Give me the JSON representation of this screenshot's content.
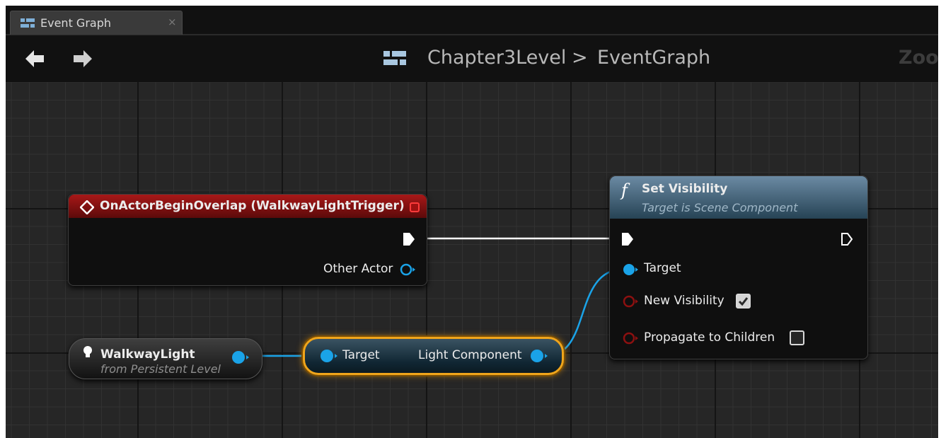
{
  "tab": {
    "label": "Event Graph",
    "close": "×"
  },
  "breadcrumb": {
    "level": "Chapter3Level",
    "separator": ">",
    "graph": "EventGraph",
    "zoom": "Zoom"
  },
  "nodes": {
    "overlap_event": {
      "title": "OnActorBeginOverlap (WalkwayLightTrigger)",
      "pin_other_actor": "Other Actor"
    },
    "set_visibility": {
      "title": "Set Visibility",
      "subtitle": "Target is Scene Component",
      "pin_target": "Target",
      "pin_new_visibility": "New Visibility",
      "pin_propagate": "Propagate to Children",
      "new_visibility_checked": true,
      "propagate_checked": false
    },
    "walkway_light": {
      "title": "WalkwayLight",
      "subtitle": "from Persistent Level"
    },
    "get_light_component": {
      "pin_target": "Target",
      "pin_output": "Light Component"
    }
  },
  "colors": {
    "event_header": "#a81818",
    "function_header": "#4e6f86",
    "object_pin": "#1aa3e8",
    "bool_pin": "#8c1010",
    "exec_pin": "#ffffff",
    "selection": "#f0a51b"
  }
}
